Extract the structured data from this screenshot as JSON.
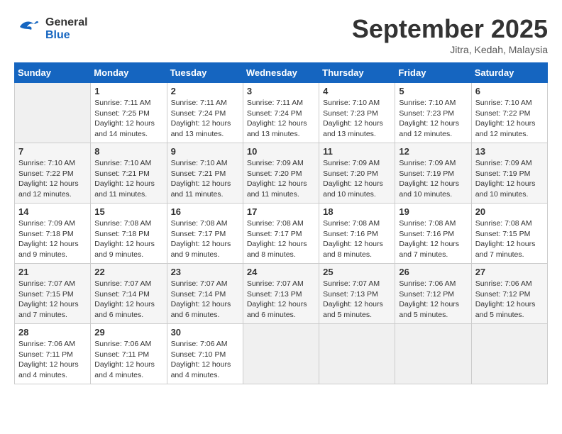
{
  "header": {
    "logo_line1": "General",
    "logo_line2": "Blue",
    "month": "September 2025",
    "location": "Jitra, Kedah, Malaysia"
  },
  "days_of_week": [
    "Sunday",
    "Monday",
    "Tuesday",
    "Wednesday",
    "Thursday",
    "Friday",
    "Saturday"
  ],
  "weeks": [
    [
      null,
      {
        "day": 1,
        "sunrise": "7:11 AM",
        "sunset": "7:25 PM",
        "daylight": "12 hours and 14 minutes."
      },
      {
        "day": 2,
        "sunrise": "7:11 AM",
        "sunset": "7:24 PM",
        "daylight": "12 hours and 13 minutes."
      },
      {
        "day": 3,
        "sunrise": "7:11 AM",
        "sunset": "7:24 PM",
        "daylight": "12 hours and 13 minutes."
      },
      {
        "day": 4,
        "sunrise": "7:10 AM",
        "sunset": "7:23 PM",
        "daylight": "12 hours and 13 minutes."
      },
      {
        "day": 5,
        "sunrise": "7:10 AM",
        "sunset": "7:23 PM",
        "daylight": "12 hours and 12 minutes."
      },
      {
        "day": 6,
        "sunrise": "7:10 AM",
        "sunset": "7:22 PM",
        "daylight": "12 hours and 12 minutes."
      }
    ],
    [
      {
        "day": 7,
        "sunrise": "7:10 AM",
        "sunset": "7:22 PM",
        "daylight": "12 hours and 12 minutes."
      },
      {
        "day": 8,
        "sunrise": "7:10 AM",
        "sunset": "7:21 PM",
        "daylight": "12 hours and 11 minutes."
      },
      {
        "day": 9,
        "sunrise": "7:10 AM",
        "sunset": "7:21 PM",
        "daylight": "12 hours and 11 minutes."
      },
      {
        "day": 10,
        "sunrise": "7:09 AM",
        "sunset": "7:20 PM",
        "daylight": "12 hours and 11 minutes."
      },
      {
        "day": 11,
        "sunrise": "7:09 AM",
        "sunset": "7:20 PM",
        "daylight": "12 hours and 10 minutes."
      },
      {
        "day": 12,
        "sunrise": "7:09 AM",
        "sunset": "7:19 PM",
        "daylight": "12 hours and 10 minutes."
      },
      {
        "day": 13,
        "sunrise": "7:09 AM",
        "sunset": "7:19 PM",
        "daylight": "12 hours and 10 minutes."
      }
    ],
    [
      {
        "day": 14,
        "sunrise": "7:09 AM",
        "sunset": "7:18 PM",
        "daylight": "12 hours and 9 minutes."
      },
      {
        "day": 15,
        "sunrise": "7:08 AM",
        "sunset": "7:18 PM",
        "daylight": "12 hours and 9 minutes."
      },
      {
        "day": 16,
        "sunrise": "7:08 AM",
        "sunset": "7:17 PM",
        "daylight": "12 hours and 9 minutes."
      },
      {
        "day": 17,
        "sunrise": "7:08 AM",
        "sunset": "7:17 PM",
        "daylight": "12 hours and 8 minutes."
      },
      {
        "day": 18,
        "sunrise": "7:08 AM",
        "sunset": "7:16 PM",
        "daylight": "12 hours and 8 minutes."
      },
      {
        "day": 19,
        "sunrise": "7:08 AM",
        "sunset": "7:16 PM",
        "daylight": "12 hours and 7 minutes."
      },
      {
        "day": 20,
        "sunrise": "7:08 AM",
        "sunset": "7:15 PM",
        "daylight": "12 hours and 7 minutes."
      }
    ],
    [
      {
        "day": 21,
        "sunrise": "7:07 AM",
        "sunset": "7:15 PM",
        "daylight": "12 hours and 7 minutes."
      },
      {
        "day": 22,
        "sunrise": "7:07 AM",
        "sunset": "7:14 PM",
        "daylight": "12 hours and 6 minutes."
      },
      {
        "day": 23,
        "sunrise": "7:07 AM",
        "sunset": "7:14 PM",
        "daylight": "12 hours and 6 minutes."
      },
      {
        "day": 24,
        "sunrise": "7:07 AM",
        "sunset": "7:13 PM",
        "daylight": "12 hours and 6 minutes."
      },
      {
        "day": 25,
        "sunrise": "7:07 AM",
        "sunset": "7:13 PM",
        "daylight": "12 hours and 5 minutes."
      },
      {
        "day": 26,
        "sunrise": "7:06 AM",
        "sunset": "7:12 PM",
        "daylight": "12 hours and 5 minutes."
      },
      {
        "day": 27,
        "sunrise": "7:06 AM",
        "sunset": "7:12 PM",
        "daylight": "12 hours and 5 minutes."
      }
    ],
    [
      {
        "day": 28,
        "sunrise": "7:06 AM",
        "sunset": "7:11 PM",
        "daylight": "12 hours and 4 minutes."
      },
      {
        "day": 29,
        "sunrise": "7:06 AM",
        "sunset": "7:11 PM",
        "daylight": "12 hours and 4 minutes."
      },
      {
        "day": 30,
        "sunrise": "7:06 AM",
        "sunset": "7:10 PM",
        "daylight": "12 hours and 4 minutes."
      },
      null,
      null,
      null,
      null
    ]
  ]
}
